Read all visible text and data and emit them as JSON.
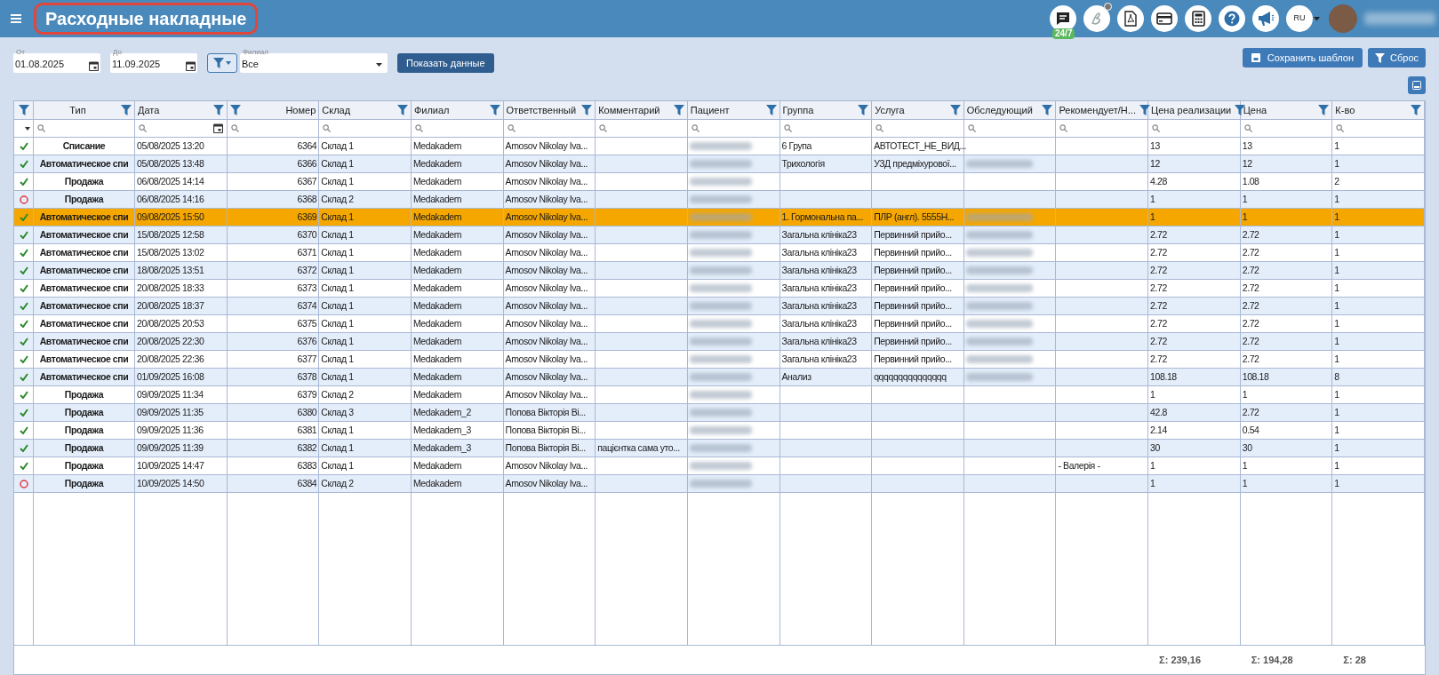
{
  "header": {
    "title": "Расходные накладные",
    "chat_badge": "24/7",
    "language": "RU"
  },
  "filters": {
    "from": {
      "label": "От",
      "value": "01.08.2025"
    },
    "to": {
      "label": "До",
      "value": "11.09.2025"
    },
    "branch": {
      "label": "Филиал",
      "value": "Все"
    },
    "show_button": "Показать данные",
    "save_button": "Сохранить шаблон",
    "reset_button": "Сброс"
  },
  "table": {
    "columns": [
      "Тип",
      "Дата",
      "Номер",
      "Склад",
      "Филиал",
      "Ответственный",
      "Комментарий",
      "Пациент",
      "Группа",
      "Услуга",
      "Обследующий",
      "Рекомендует/Н...",
      "Цена реализации",
      "Цена",
      "К-во"
    ],
    "rows": [
      {
        "completed": true,
        "selected": false,
        "type": "Списание",
        "date": "05/08/2025 13:20",
        "number": "6364",
        "warehouse": "Склад 1",
        "branch": "Medakadem",
        "responsible": "Amosov Nikolay Iva...",
        "patient_blurred": true,
        "group": "6 Група",
        "service": "АВТОТЕСТ_НЕ_ВИД...",
        "examiner_blurred": false,
        "sale_price": "13",
        "price": "13",
        "qty": "1"
      },
      {
        "completed": true,
        "selected": false,
        "type": "Автоматическое спи",
        "date": "05/08/2025 13:48",
        "number": "6366",
        "warehouse": "Склад 1",
        "branch": "Medakadem",
        "responsible": "Amosov Nikolay Iva...",
        "patient_blurred": true,
        "group": "Трихологія",
        "service": "УЗД предміхурової...",
        "examiner_blurred": true,
        "sale_price": "12",
        "price": "12",
        "qty": "1"
      },
      {
        "completed": true,
        "selected": false,
        "type": "Продажа",
        "date": "06/08/2025 14:14",
        "number": "6367",
        "warehouse": "Склад 1",
        "branch": "Medakadem",
        "responsible": "Amosov Nikolay Iva...",
        "patient_blurred": true,
        "examiner_blurred": false,
        "sale_price": "4.28",
        "price": "1.08",
        "qty": "2"
      },
      {
        "completed": false,
        "selected": false,
        "type": "Продажа",
        "date": "06/08/2025 14:16",
        "number": "6368",
        "warehouse": "Склад 2",
        "branch": "Medakadem",
        "responsible": "Amosov Nikolay Iva...",
        "patient_blurred": true,
        "examiner_blurred": false,
        "sale_price": "1",
        "price": "1",
        "qty": "1"
      },
      {
        "completed": true,
        "selected": true,
        "type": "Автоматическое спи",
        "date": "09/08/2025 15:50",
        "number": "6369",
        "warehouse": "Склад 1",
        "branch": "Medakadem",
        "responsible": "Amosov Nikolay Iva...",
        "patient_blurred": true,
        "group": "1. Гормональна па...",
        "service": "ПЛР (англ). 5555Н...",
        "examiner_blurred": true,
        "sale_price": "1",
        "price": "1",
        "qty": "1"
      },
      {
        "completed": true,
        "selected": false,
        "type": "Автоматическое спи",
        "date": "15/08/2025 12:58",
        "number": "6370",
        "warehouse": "Склад 1",
        "branch": "Medakadem",
        "responsible": "Amosov Nikolay Iva...",
        "patient_blurred": true,
        "group": "Загальна клініка23",
        "service": "Первинний прийо...",
        "examiner_blurred": true,
        "sale_price": "2.72",
        "price": "2.72",
        "qty": "1"
      },
      {
        "completed": true,
        "selected": false,
        "type": "Автоматическое спи",
        "date": "15/08/2025 13:02",
        "number": "6371",
        "warehouse": "Склад 1",
        "branch": "Medakadem",
        "responsible": "Amosov Nikolay Iva...",
        "patient_blurred": true,
        "group": "Загальна клініка23",
        "service": "Первинний прийо...",
        "examiner_blurred": true,
        "sale_price": "2.72",
        "price": "2.72",
        "qty": "1"
      },
      {
        "completed": true,
        "selected": false,
        "type": "Автоматическое спи",
        "date": "18/08/2025 13:51",
        "number": "6372",
        "warehouse": "Склад 1",
        "branch": "Medakadem",
        "responsible": "Amosov Nikolay Iva...",
        "patient_blurred": true,
        "group": "Загальна клініка23",
        "service": "Первинний прийо...",
        "examiner_blurred": true,
        "sale_price": "2.72",
        "price": "2.72",
        "qty": "1"
      },
      {
        "completed": true,
        "selected": false,
        "type": "Автоматическое спи",
        "date": "20/08/2025 18:33",
        "number": "6373",
        "warehouse": "Склад 1",
        "branch": "Medakadem",
        "responsible": "Amosov Nikolay Iva...",
        "patient_blurred": true,
        "group": "Загальна клініка23",
        "service": "Первинний прийо...",
        "examiner_blurred": true,
        "sale_price": "2.72",
        "price": "2.72",
        "qty": "1"
      },
      {
        "completed": true,
        "selected": false,
        "type": "Автоматическое спи",
        "date": "20/08/2025 18:37",
        "number": "6374",
        "warehouse": "Склад 1",
        "branch": "Medakadem",
        "responsible": "Amosov Nikolay Iva...",
        "patient_blurred": true,
        "group": "Загальна клініка23",
        "service": "Первинний прийо...",
        "examiner_blurred": true,
        "sale_price": "2.72",
        "price": "2.72",
        "qty": "1"
      },
      {
        "completed": true,
        "selected": false,
        "type": "Автоматическое спи",
        "date": "20/08/2025 20:53",
        "number": "6375",
        "warehouse": "Склад 1",
        "branch": "Medakadem",
        "responsible": "Amosov Nikolay Iva...",
        "patient_blurred": true,
        "group": "Загальна клініка23",
        "service": "Первинний прийо...",
        "examiner_blurred": true,
        "sale_price": "2.72",
        "price": "2.72",
        "qty": "1"
      },
      {
        "completed": true,
        "selected": false,
        "type": "Автоматическое спи",
        "date": "20/08/2025 22:30",
        "number": "6376",
        "warehouse": "Склад 1",
        "branch": "Medakadem",
        "responsible": "Amosov Nikolay Iva...",
        "patient_blurred": true,
        "group": "Загальна клініка23",
        "service": "Первинний прийо...",
        "examiner_blurred": true,
        "sale_price": "2.72",
        "price": "2.72",
        "qty": "1"
      },
      {
        "completed": true,
        "selected": false,
        "type": "Автоматическое спи",
        "date": "20/08/2025 22:36",
        "number": "6377",
        "warehouse": "Склад 1",
        "branch": "Medakadem",
        "responsible": "Amosov Nikolay Iva...",
        "patient_blurred": true,
        "group": "Загальна клініка23",
        "service": "Первинний прийо...",
        "examiner_blurred": true,
        "sale_price": "2.72",
        "price": "2.72",
        "qty": "1"
      },
      {
        "completed": true,
        "selected": false,
        "type": "Автоматическое спи",
        "date": "01/09/2025 16:08",
        "number": "6378",
        "warehouse": "Склад 1",
        "branch": "Medakadem",
        "responsible": "Amosov Nikolay Iva...",
        "patient_blurred": true,
        "group": "Анализ",
        "service": "qqqqqqqqqqqqqqq",
        "examiner_blurred": true,
        "sale_price": "108.18",
        "price": "108.18",
        "qty": "8"
      },
      {
        "completed": true,
        "selected": false,
        "type": "Продажа",
        "date": "09/09/2025 11:34",
        "number": "6379",
        "warehouse": "Склад 2",
        "branch": "Medakadem",
        "responsible": "Amosov Nikolay Iva...",
        "patient_blurred": true,
        "examiner_blurred": false,
        "sale_price": "1",
        "price": "1",
        "qty": "1"
      },
      {
        "completed": true,
        "selected": false,
        "type": "Продажа",
        "date": "09/09/2025 11:35",
        "number": "6380",
        "warehouse": "Склад 3",
        "branch": "Medakadem_2",
        "responsible": "Попова Вікторія Ві...",
        "patient_blurred": true,
        "examiner_blurred": false,
        "sale_price": "42.8",
        "price": "2.72",
        "qty": "1"
      },
      {
        "completed": true,
        "selected": false,
        "type": "Продажа",
        "date": "09/09/2025 11:36",
        "number": "6381",
        "warehouse": "Склад 1",
        "branch": "Medakadem_3",
        "responsible": "Попова Вікторія Ві...",
        "patient_blurred": true,
        "examiner_blurred": false,
        "sale_price": "2.14",
        "price": "0.54",
        "qty": "1"
      },
      {
        "completed": true,
        "selected": false,
        "type": "Продажа",
        "date": "09/09/2025 11:39",
        "number": "6382",
        "warehouse": "Склад 1",
        "branch": "Medakadem_3",
        "responsible": "Попова Вікторія Ві...",
        "comment": "пацієнтка сама уто...",
        "patient_blurred": true,
        "examiner_blurred": false,
        "sale_price": "30",
        "price": "30",
        "qty": "1"
      },
      {
        "completed": true,
        "selected": false,
        "type": "Продажа",
        "date": "10/09/2025 14:47",
        "number": "6383",
        "warehouse": "Склад 1",
        "branch": "Medakadem",
        "responsible": "Amosov Nikolay Iva...",
        "patient_blurred": true,
        "examiner_blurred": false,
        "recommends": "- Валерія -",
        "sale_price": "1",
        "price": "1",
        "qty": "1"
      },
      {
        "completed": false,
        "selected": false,
        "type": "Продажа",
        "date": "10/09/2025 14:50",
        "number": "6384",
        "warehouse": "Склад 2",
        "branch": "Medakadem",
        "responsible": "Amosov Nikolay Iva...",
        "patient_blurred": true,
        "examiner_blurred": false,
        "sale_price": "1",
        "price": "1",
        "qty": "1"
      }
    ],
    "totals": {
      "sale_price": "Σ: 239,16",
      "price": "Σ: 194,28",
      "qty": "Σ: 28"
    }
  }
}
